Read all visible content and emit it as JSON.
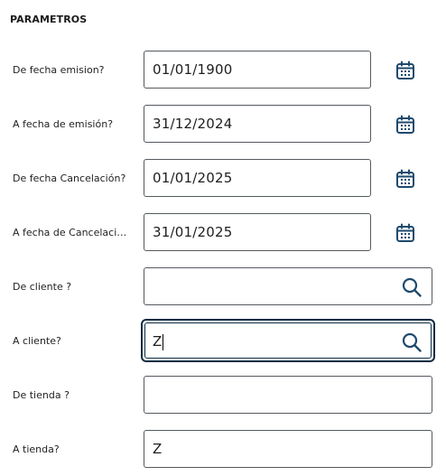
{
  "section": {
    "title": "PARAMETROS"
  },
  "fields": [
    {
      "label": "De fecha emision?",
      "value": "01/01/1900",
      "type": "date",
      "icon": "calendar-icon"
    },
    {
      "label": "A fecha de emisión?",
      "value": "31/12/2024",
      "type": "date",
      "icon": "calendar-icon"
    },
    {
      "label": "De fecha Cancelación?",
      "value": "01/01/2025",
      "type": "date",
      "icon": "calendar-icon"
    },
    {
      "label": "A fecha de Cancelació...",
      "value": "31/01/2025",
      "type": "date",
      "icon": "calendar-icon"
    },
    {
      "label": "De cliente ?",
      "value": "",
      "type": "lookup",
      "icon": "search-icon"
    },
    {
      "label": "A cliente?",
      "value": "Z",
      "type": "lookup",
      "icon": "search-icon",
      "focused": true
    },
    {
      "label": "De tienda ?",
      "value": "",
      "type": "text"
    },
    {
      "label": "A tienda?",
      "value": "Z",
      "type": "text"
    }
  ],
  "colors": {
    "icon": "#1e4a6e",
    "border": "#555a5f",
    "focus_border": "#0c2c44"
  }
}
